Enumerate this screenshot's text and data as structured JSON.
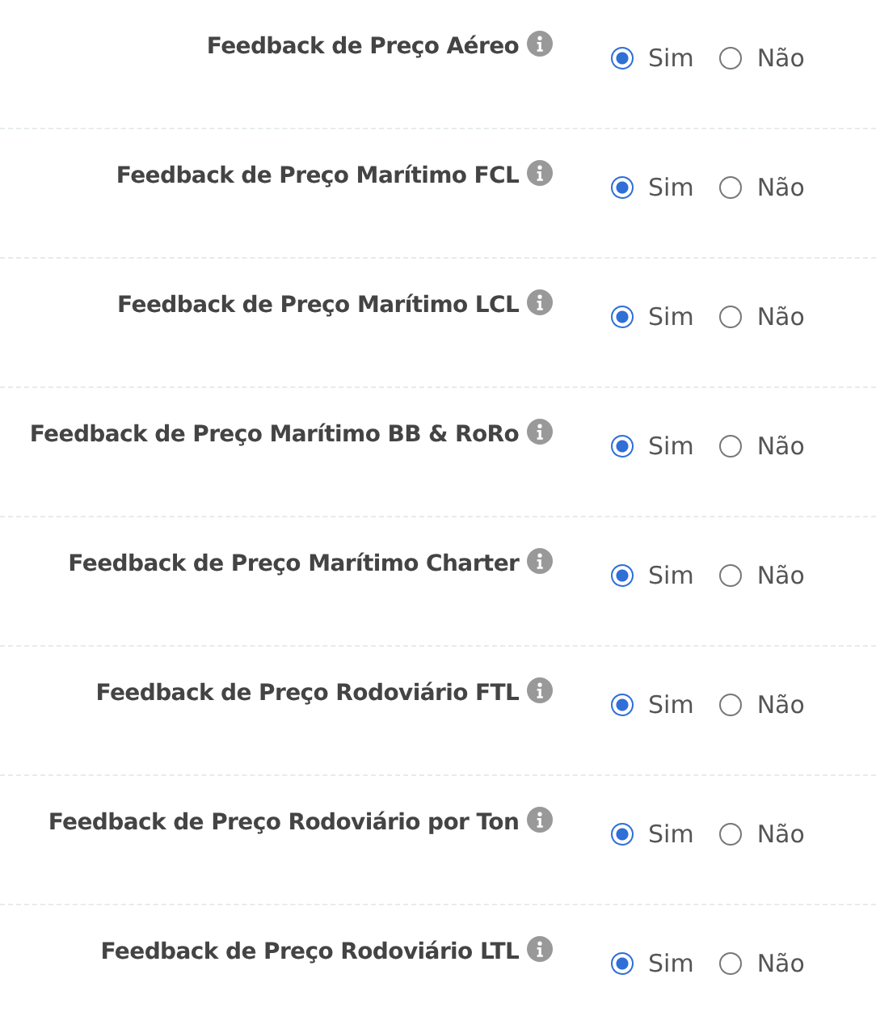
{
  "settings": [
    {
      "label": "Feedback de Preço Aéreo",
      "options": [
        {
          "label": "Sim",
          "selected": true
        },
        {
          "label": "Não",
          "selected": false
        }
      ]
    },
    {
      "label": "Feedback de Preço Marítimo FCL",
      "options": [
        {
          "label": "Sim",
          "selected": true
        },
        {
          "label": "Não",
          "selected": false
        }
      ]
    },
    {
      "label": "Feedback de Preço Marítimo LCL",
      "options": [
        {
          "label": "Sim",
          "selected": true
        },
        {
          "label": "Não",
          "selected": false
        }
      ]
    },
    {
      "label": "Feedback de Preço Marítimo BB & RoRo",
      "options": [
        {
          "label": "Sim",
          "selected": true
        },
        {
          "label": "Não",
          "selected": false
        }
      ]
    },
    {
      "label": "Feedback de Preço Marítimo Charter",
      "options": [
        {
          "label": "Sim",
          "selected": true
        },
        {
          "label": "Não",
          "selected": false
        }
      ]
    },
    {
      "label": "Feedback de Preço Rodoviário FTL",
      "options": [
        {
          "label": "Sim",
          "selected": true
        },
        {
          "label": "Não",
          "selected": false
        }
      ]
    },
    {
      "label": "Feedback de Preço Rodoviário por Ton",
      "options": [
        {
          "label": "Sim",
          "selected": true
        },
        {
          "label": "Não",
          "selected": false
        }
      ]
    },
    {
      "label": "Feedback de Preço Rodoviário LTL",
      "options": [
        {
          "label": "Sim",
          "selected": true
        },
        {
          "label": "Não",
          "selected": false
        }
      ]
    }
  ]
}
